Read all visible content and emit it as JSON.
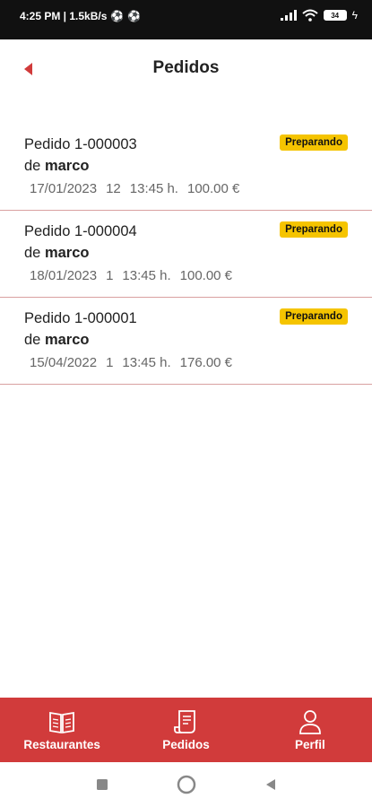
{
  "status_bar": {
    "time_speed": "4:25 PM | 1.5kB/s",
    "battery": "34"
  },
  "header": {
    "title": "Pedidos"
  },
  "orders": [
    {
      "title": "Pedido 1-000003",
      "by_prefix": "de",
      "customer": "marco",
      "date": "17/01/2023",
      "items": "12",
      "time": "13:45 h.",
      "total": "100.00 €",
      "status": "Preparando"
    },
    {
      "title": "Pedido 1-000004",
      "by_prefix": "de",
      "customer": "marco",
      "date": "18/01/2023",
      "items": "1",
      "time": "13:45 h.",
      "total": "100.00 €",
      "status": "Preparando"
    },
    {
      "title": "Pedido 1-000001",
      "by_prefix": "de",
      "customer": "marco",
      "date": "15/04/2022",
      "items": "1",
      "time": "13:45 h.",
      "total": "176.00 €",
      "status": "Preparando"
    }
  ],
  "bottom_nav": {
    "restaurants_label": "Restaurantes",
    "orders_label": "Pedidos",
    "profile_label": "Perfil"
  },
  "colors": {
    "accent": "#d13b3b",
    "badge": "#f5c400"
  }
}
